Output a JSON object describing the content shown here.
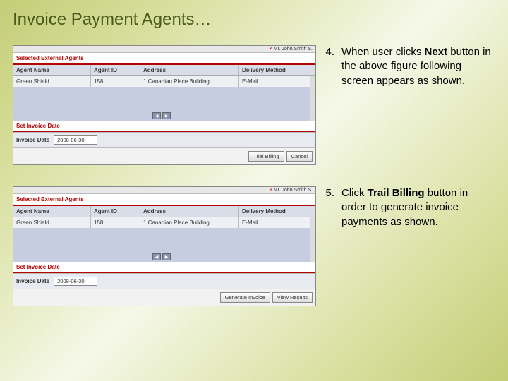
{
  "title": "Invoice Payment Agents…",
  "steps": [
    {
      "num": "4.",
      "text_parts": [
        "When user clicks ",
        "Next",
        " button in the above figure following screen appears as shown."
      ],
      "bold_index": 1
    },
    {
      "num": "5.",
      "text_parts": [
        "Click ",
        "Trail Billing",
        " button in order to generate invoice payments as shown."
      ],
      "bold_index": 1
    }
  ],
  "screenshot": {
    "tab_user": "Mr. John Smith S.",
    "tab_close": "×",
    "section_header": "Selected External Agents",
    "columns": [
      "Agent Name",
      "Agent ID",
      "Address",
      "Delivery Method"
    ],
    "row": [
      "Green Shield",
      "158",
      "1 Canadian Place Building",
      "E-Mail"
    ],
    "pager_prev": "◀",
    "pager_next": "▶",
    "date_section": "Set Invoice Date",
    "date_label": "Invoice Date",
    "date_value": "2008-06-30",
    "buttons_a": [
      "Trial Billing",
      "Cancel"
    ],
    "buttons_b": [
      "Generate Invoice",
      "View Results"
    ]
  }
}
